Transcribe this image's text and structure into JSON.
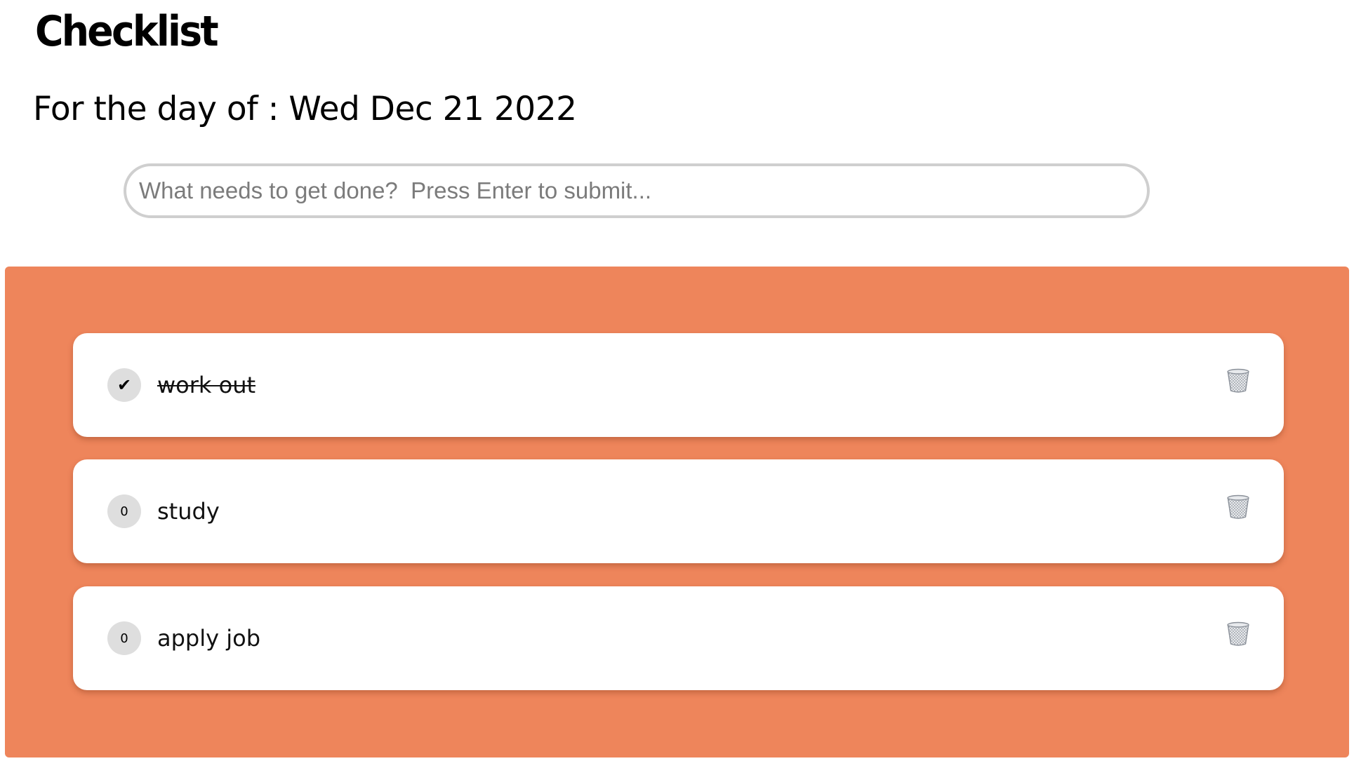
{
  "app": {
    "title": "Checklist"
  },
  "header": {
    "date_line": "For the day of : Wed Dec 21 2022"
  },
  "new_task": {
    "placeholder": "What needs to get done?  Press Enter to submit...",
    "value": ""
  },
  "colors": {
    "panel_background": "#ee855b",
    "card_background": "#ffffff",
    "toggle_background": "#dedede"
  },
  "tasks": [
    {
      "text": "work out",
      "status_symbol": "✔",
      "completed": true,
      "delete_icon": "trash-icon"
    },
    {
      "text": "study",
      "status_symbol": "0",
      "completed": false,
      "delete_icon": "trash-icon"
    },
    {
      "text": "apply job",
      "status_symbol": "0",
      "completed": false,
      "delete_icon": "trash-icon"
    }
  ]
}
